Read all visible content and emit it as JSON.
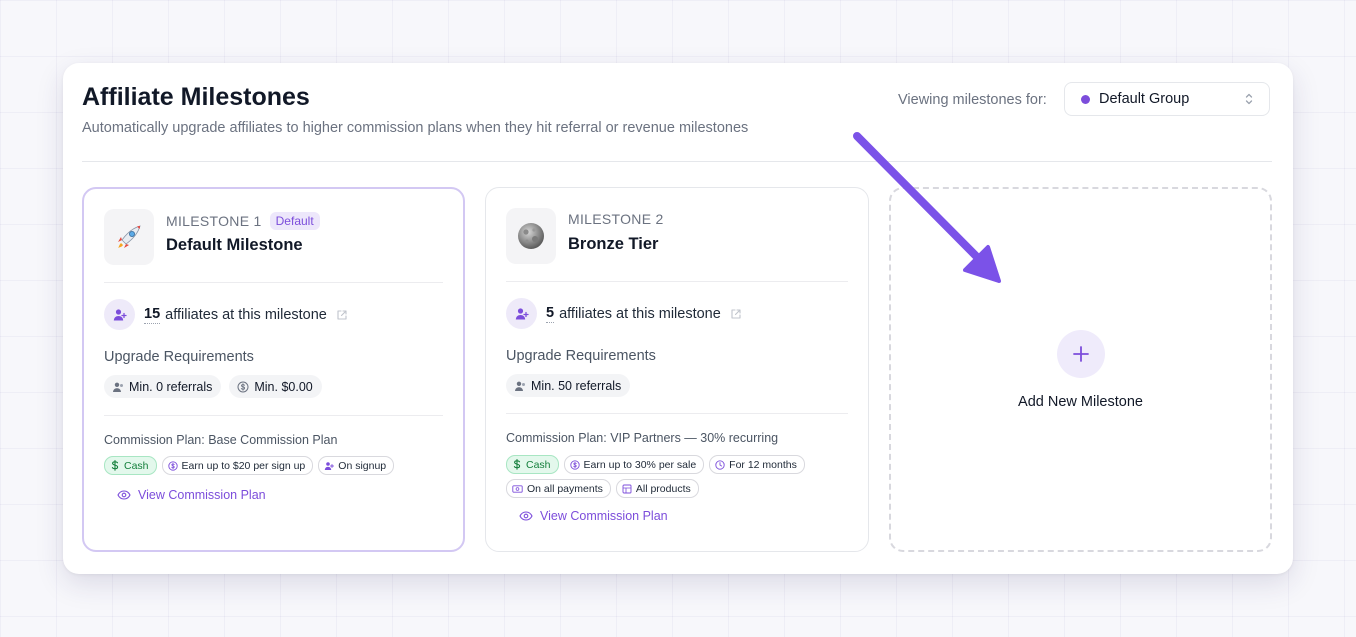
{
  "header": {
    "title": "Affiliate Milestones",
    "subtitle": "Automatically upgrade affiliates to higher commission plans when they hit referral or revenue milestones",
    "viewing_label": "Viewing milestones for:",
    "group_select": {
      "value": "Default Group",
      "dot_color": "#7c4ddb"
    }
  },
  "milestones": [
    {
      "label": "MILESTONE 1",
      "badge": "Default",
      "name": "Default Milestone",
      "icon": "rocket-icon",
      "affiliate_count": "15",
      "affiliate_text": "affiliates at this milestone",
      "requirements_title": "Upgrade Requirements",
      "requirements": [
        "Min. 0 referrals",
        "Min. $0.00"
      ],
      "plan_title": "Commission Plan: Base Commission Plan",
      "tags": [
        "Cash",
        "Earn up to $20 per sign up",
        "On signup"
      ],
      "view_link": "View Commission Plan"
    },
    {
      "label": "MILESTONE 2",
      "name": "Bronze Tier",
      "icon": "moon-icon",
      "affiliate_count": "5",
      "affiliate_text": "affiliates at this milestone",
      "requirements_title": "Upgrade Requirements",
      "requirements": [
        "Min. 50 referrals"
      ],
      "plan_title": "Commission Plan: VIP Partners — 30% recurring",
      "tags": [
        "Cash",
        "Earn up to 30% per sale",
        "For 12 months",
        "On all payments",
        "All products"
      ],
      "view_link": "View Commission Plan"
    }
  ],
  "add_milestone": {
    "label": "Add New Milestone"
  },
  "colors": {
    "accent": "#7c4ddb",
    "arrow": "#7b52e8",
    "cash_bg": "#e3f8ec",
    "cash_text": "#15803d"
  }
}
